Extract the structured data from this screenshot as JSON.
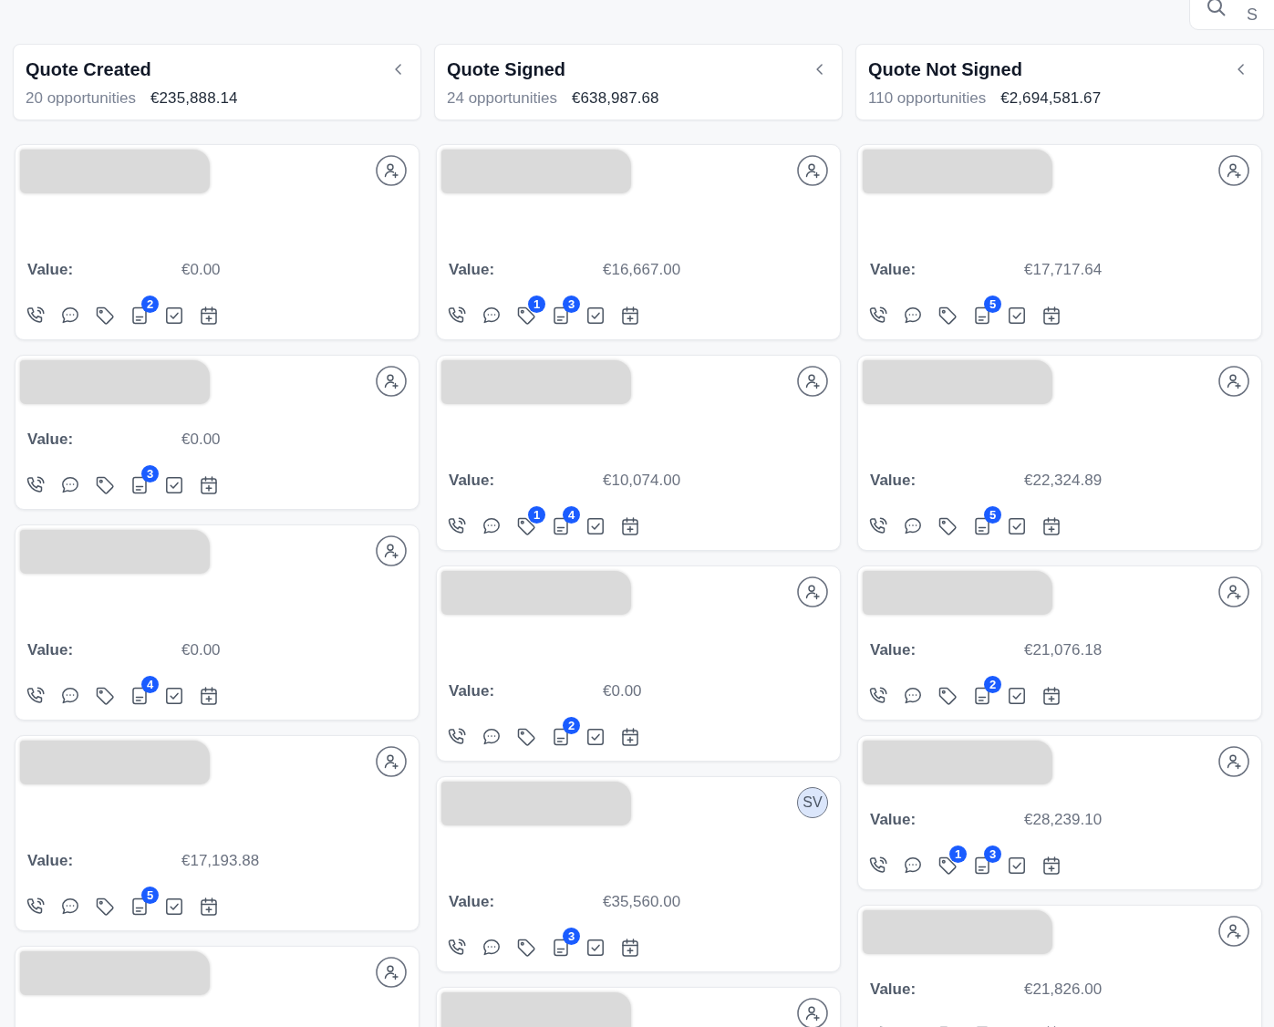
{
  "search": {
    "placeholder": "S"
  },
  "columns": [
    {
      "title": "Quote Created",
      "count": "20 opportunities",
      "total": "€235,888.14",
      "cards": [
        {
          "spacious": true,
          "assignee": {
            "kind": "add"
          },
          "value_label": "Value:",
          "value": "€0.00",
          "note_badge": "2"
        },
        {
          "spacious": false,
          "assignee": {
            "kind": "add"
          },
          "value_label": "Value:",
          "value": "€0.00",
          "note_badge": "3"
        },
        {
          "spacious": true,
          "assignee": {
            "kind": "add"
          },
          "value_label": "Value:",
          "value": "€0.00",
          "note_badge": "4"
        },
        {
          "spacious": true,
          "assignee": {
            "kind": "add"
          },
          "value_label": "Value:",
          "value": "€17,193.88",
          "note_badge": "5"
        },
        {
          "spacious": true,
          "assignee": {
            "kind": "add"
          }
        }
      ]
    },
    {
      "title": "Quote Signed",
      "count": "24 opportunities",
      "total": "€638,987.68",
      "cards": [
        {
          "spacious": true,
          "assignee": {
            "kind": "add"
          },
          "value_label": "Value:",
          "value": "€16,667.00",
          "tag_badge": "1",
          "note_badge": "3"
        },
        {
          "spacious": true,
          "assignee": {
            "kind": "add"
          },
          "value_label": "Value:",
          "value": "€10,074.00",
          "tag_badge": "1",
          "note_badge": "4"
        },
        {
          "spacious": true,
          "assignee": {
            "kind": "add"
          },
          "value_label": "Value:",
          "value": "€0.00",
          "note_badge": "2"
        },
        {
          "spacious": true,
          "assignee": {
            "kind": "initials",
            "initials": "SV"
          },
          "value_label": "Value:",
          "value": "€35,560.00",
          "note_badge": "3"
        },
        {
          "assignee": {
            "kind": "add"
          }
        }
      ]
    },
    {
      "title": "Quote Not Signed",
      "count": "110 opportunities",
      "total": "€2,694,581.67",
      "cards": [
        {
          "spacious": true,
          "assignee": {
            "kind": "add"
          },
          "value_label": "Value:",
          "value": "€17,717.64",
          "note_badge": "5"
        },
        {
          "spacious": true,
          "assignee": {
            "kind": "add"
          },
          "value_label": "Value:",
          "value": "€22,324.89",
          "note_badge": "5"
        },
        {
          "spacious": false,
          "assignee": {
            "kind": "add"
          },
          "value_label": "Value:",
          "value": "€21,076.18",
          "note_badge": "2"
        },
        {
          "spacious": false,
          "assignee": {
            "kind": "add"
          },
          "value_label": "Value:",
          "value": "€28,239.10",
          "tag_badge": "1",
          "note_badge": "3"
        },
        {
          "spacious": false,
          "assignee": {
            "kind": "add"
          },
          "value_label": "Value:",
          "value": "€21,826.00"
        }
      ]
    }
  ]
}
